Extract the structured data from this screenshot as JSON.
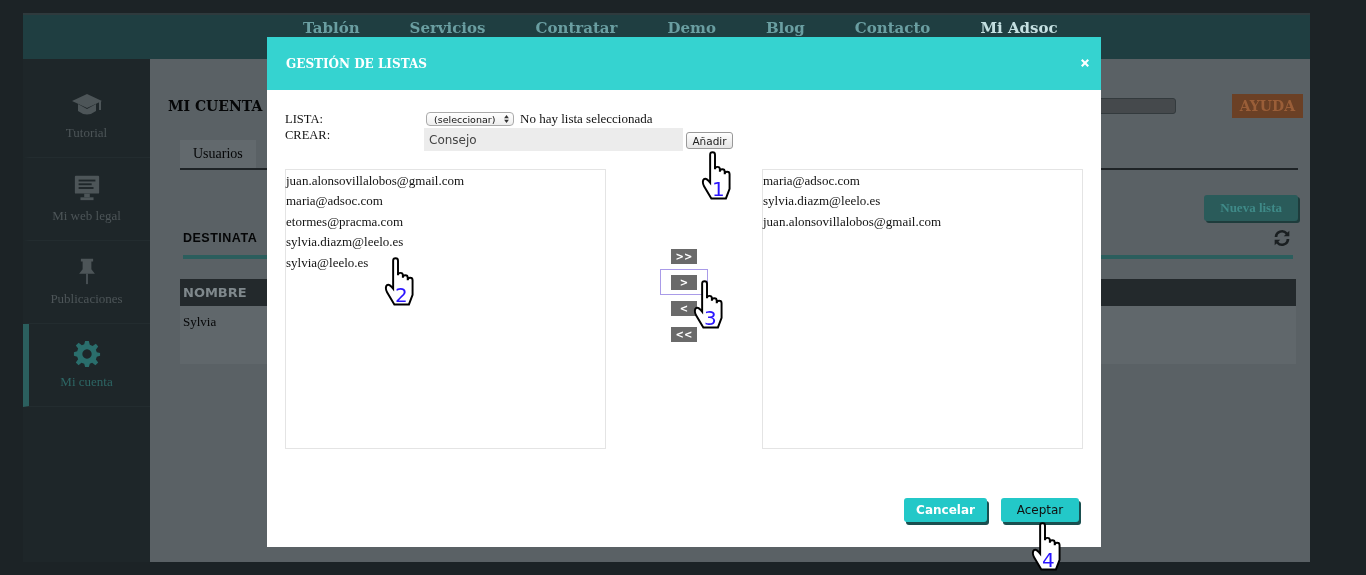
{
  "nav": [
    {
      "label": "Tablón",
      "selected": false
    },
    {
      "label": "Servicios",
      "selected": false
    },
    {
      "label": "Contratar",
      "selected": false
    },
    {
      "label": "Demo",
      "selected": false
    },
    {
      "label": "Blog",
      "selected": false
    },
    {
      "label": "Contacto",
      "selected": false
    },
    {
      "label": "Mi Adsoc",
      "selected": true
    }
  ],
  "sidebar": {
    "items": [
      {
        "label": "Tutorial",
        "kind": "cap",
        "selected": false
      },
      {
        "label": "Mi web legal",
        "kind": "monitor",
        "selected": false
      },
      {
        "label": "Publicaciones",
        "kind": "pin",
        "selected": false
      },
      {
        "label": "Mi cuenta",
        "kind": "gear",
        "selected": true
      }
    ]
  },
  "page": {
    "title": "MI CUENTA",
    "help_button": "AYUDA",
    "tabs": [
      {
        "label": "Usuarios",
        "selected": false
      }
    ],
    "new_list_button": "Nueva lista",
    "section_title": "DESTINATA",
    "table": {
      "columns": [
        "NOMBRE"
      ],
      "rows": [
        [
          "Sylvia"
        ]
      ]
    }
  },
  "dialog": {
    "title": "GESTIÓN DE LISTAS",
    "list_label": "LISTA:",
    "list_select": "(seleccionar)",
    "list_status": "No hay lista seleccionada",
    "create_label": "CREAR:",
    "create_value": "Consejo",
    "add_button": "Añadir",
    "available": [
      "juan.alonsovillalobos@gmail.com",
      "maria@adsoc.com",
      "etormes@pracma.com",
      "sylvia.diazm@leelo.es",
      "sylvia@leelo.es"
    ],
    "chosen": [
      "maria@adsoc.com",
      "sylvia.diazm@leelo.es",
      "juan.alonsovillalobos@gmail.com"
    ],
    "move_buttons": [
      {
        "label": ">>",
        "focused": false
      },
      {
        "label": ">",
        "focused": true
      },
      {
        "label": "<",
        "focused": false
      },
      {
        "label": "<<",
        "focused": false
      }
    ],
    "cancel_button": "Cancelar",
    "accept_button": "Aceptar"
  },
  "annotations": [
    {
      "number": "1"
    },
    {
      "number": "2"
    },
    {
      "number": "3"
    },
    {
      "number": "4"
    }
  ]
}
